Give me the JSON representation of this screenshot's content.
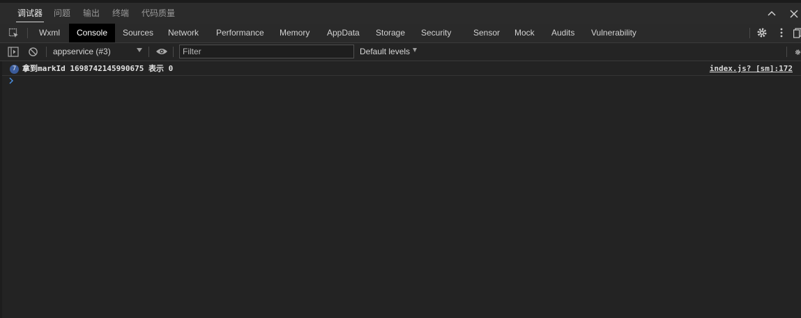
{
  "panel_tabs": [
    "调试器",
    "问题",
    "输出",
    "终端",
    "代码质量"
  ],
  "active_panel_tab": "调试器",
  "tool_tabs": [
    "Wxml",
    "Console",
    "Sources",
    "Network",
    "Performance",
    "Memory",
    "AppData",
    "Storage",
    "Security",
    "Sensor",
    "Mock",
    "Audits",
    "Vulnerability"
  ],
  "active_tool_tab": "Console",
  "console_toolbar": {
    "context": "appservice (#3)",
    "filter_placeholder": "Filter",
    "levels": "Default levels"
  },
  "log": {
    "count": "7",
    "message": "拿到markId 1698742145990675 表示 0",
    "source": "index.js? [sm]:172"
  },
  "colors": {
    "background": "#232323",
    "toolbar": "#2a2a2a",
    "active_tab": "#000000",
    "badge": "#3b5c9c",
    "prompt": "#4a8fe0"
  }
}
